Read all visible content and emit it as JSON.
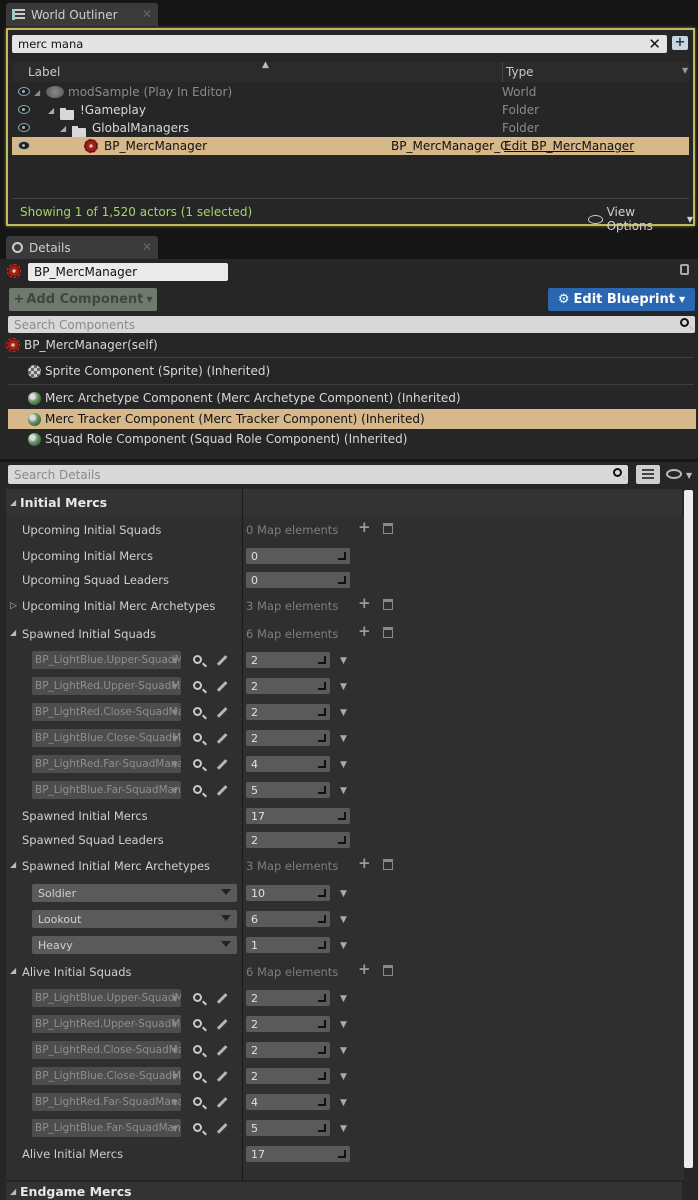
{
  "outliner": {
    "tab_title": "World Outliner",
    "search_value": "merc mana",
    "col_label": "Label",
    "col_type": "Type",
    "rows": [
      {
        "label": "modSample (Play In Editor)",
        "type": "World"
      },
      {
        "label": "!Gameplay",
        "type": "Folder"
      },
      {
        "label": "GlobalManagers",
        "type": "Folder"
      },
      {
        "label": "BP_MercManager",
        "class": "BP_MercManager_C",
        "type": "Edit BP_MercManager"
      }
    ],
    "status": "Showing 1 of 1,520 actors (1 selected)",
    "view_options": "View Options"
  },
  "details": {
    "tab_title": "Details",
    "actor_name": "BP_MercManager",
    "add_component": "Add Component",
    "edit_blueprint": "Edit Blueprint",
    "search_components_placeholder": "Search Components",
    "search_details_placeholder": "Search Details",
    "components": [
      "BP_MercManager(self)",
      "Sprite Component (Sprite) (Inherited)",
      "Merc Archetype Component (Merc Archetype Component) (Inherited)",
      "Merc Tracker Component (Merc Tracker Component) (Inherited)",
      "Squad Role Component (Squad Role Component) (Inherited)"
    ]
  },
  "props": {
    "cat_initial": "Initial Mercs",
    "cat_endgame": "Endgame Mercs",
    "upcoming_initial_squads": {
      "label": "Upcoming Initial Squads",
      "value": "0 Map elements"
    },
    "upcoming_initial_mercs": {
      "label": "Upcoming Initial Mercs",
      "value": "0"
    },
    "upcoming_squad_leaders": {
      "label": "Upcoming Squad Leaders",
      "value": "0"
    },
    "upcoming_archetypes": {
      "label": "Upcoming Initial Merc Archetypes",
      "value": "3 Map elements"
    },
    "spawned_initial_squads": {
      "label": "Spawned Initial Squads",
      "value": "6 Map elements"
    },
    "spawned_squads_entries": [
      {
        "key": "BP_LightBlue.Upper-SquadMa",
        "value": "2"
      },
      {
        "key": "BP_LightRed.Upper-SquadMa",
        "value": "2"
      },
      {
        "key": "BP_LightRed.Close-SquadMa",
        "value": "2"
      },
      {
        "key": "BP_LightBlue.Close-SquadMa",
        "value": "2"
      },
      {
        "key": "BP_LightRed.Far-SquadMana",
        "value": "4"
      },
      {
        "key": "BP_LightBlue.Far-SquadMan",
        "value": "5"
      }
    ],
    "spawned_initial_mercs": {
      "label": "Spawned Initial Mercs",
      "value": "17"
    },
    "spawned_squad_leaders": {
      "label": "Spawned Squad Leaders",
      "value": "2"
    },
    "spawned_archetypes": {
      "label": "Spawned Initial Merc Archetypes",
      "value": "3 Map elements"
    },
    "archetype_entries": [
      {
        "key": "Soldier",
        "value": "10"
      },
      {
        "key": "Lookout",
        "value": "6"
      },
      {
        "key": "Heavy",
        "value": "1"
      }
    ],
    "alive_initial_squads": {
      "label": "Alive Initial Squads",
      "value": "6 Map elements"
    },
    "alive_squads_entries": [
      {
        "key": "BP_LightBlue.Upper-SquadMa",
        "value": "2"
      },
      {
        "key": "BP_LightRed.Upper-SquadMa",
        "value": "2"
      },
      {
        "key": "BP_LightRed.Close-SquadMa",
        "value": "2"
      },
      {
        "key": "BP_LightBlue.Close-SquadMa",
        "value": "2"
      },
      {
        "key": "BP_LightRed.Far-SquadMana",
        "value": "4"
      },
      {
        "key": "BP_LightBlue.Far-SquadMan",
        "value": "5"
      }
    ],
    "alive_initial_mercs": {
      "label": "Alive Initial Mercs",
      "value": "17"
    }
  },
  "colors": {
    "accent_yellow": "#bfbb63",
    "selection": "#d7b88a",
    "blueprint_button": "#2a67b0",
    "status_text": "#a6d26e"
  }
}
